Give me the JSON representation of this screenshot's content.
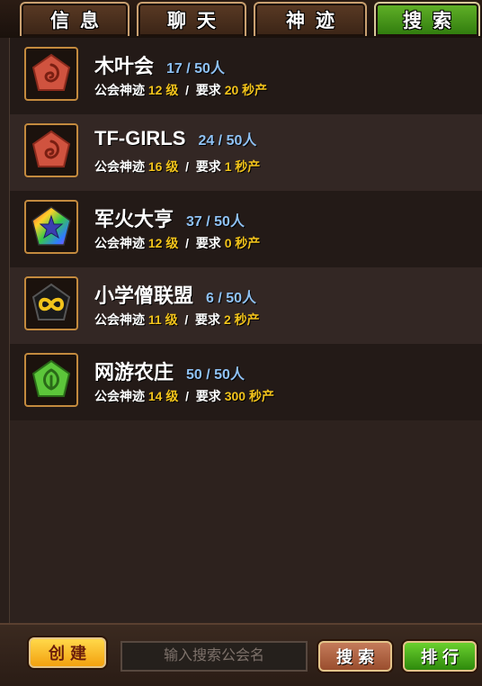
{
  "tabs": [
    {
      "label": "信息"
    },
    {
      "label": "聊天"
    },
    {
      "label": "神迹"
    },
    {
      "label": "搜索",
      "active": true
    }
  ],
  "guilds": [
    {
      "name": "木叶会",
      "count": "17 / 50人",
      "level": "12",
      "req": "20",
      "emblem": "leaf-stone-red-icon"
    },
    {
      "name": "TF-GIRLS",
      "count": "24 / 50人",
      "level": "16",
      "req": "1",
      "emblem": "leaf-stone-red-icon"
    },
    {
      "name": "军火大亨",
      "count": "37 / 50人",
      "level": "12",
      "req": "0",
      "emblem": "rainbow-star-icon"
    },
    {
      "name": "小学僧联盟",
      "count": "6 / 50人",
      "level": "11",
      "req": "2",
      "emblem": "infinity-stone-black-icon"
    },
    {
      "name": "网游农庄",
      "count": "50 / 50人",
      "level": "14",
      "req": "300",
      "emblem": "leaf-stone-green-icon"
    }
  ],
  "labels": {
    "wonder": "公会神迹",
    "level_unit": "级",
    "sep": "/",
    "require": "要求",
    "unit": "秒产"
  },
  "bottom": {
    "create_label": "创建",
    "search_placeholder": "输入搜索公会名",
    "search_label": "搜索",
    "rank_label": "排行"
  },
  "colors": {
    "accent_yellow": "#f2c31b",
    "count_blue": "#8fc2f5",
    "active_tab": "#4a9a1a"
  }
}
